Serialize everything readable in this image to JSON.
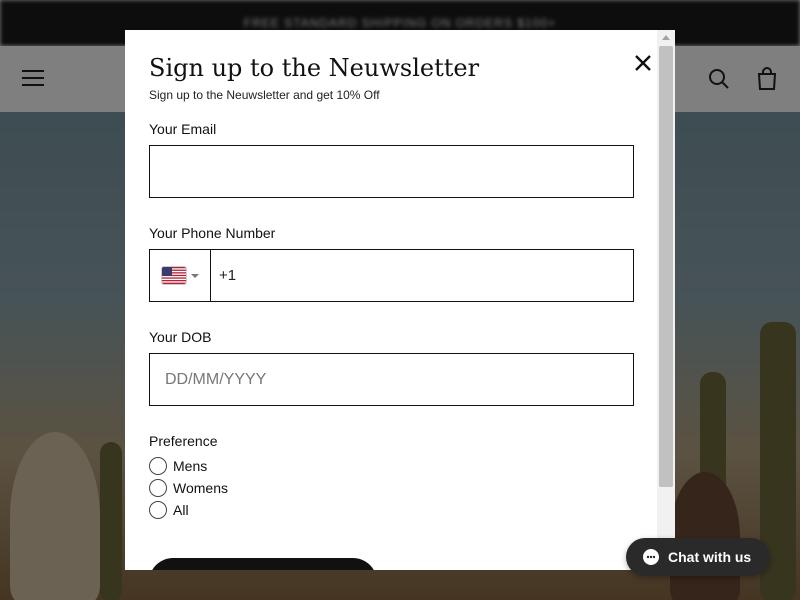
{
  "background": {
    "announcement": "FREE STANDARD SHIPPING ON ORDERS $100+"
  },
  "modal": {
    "title": "Sign up to the Neuwsletter",
    "subtitle": "Sign up to the Neuwsletter and get 10% Off",
    "close_icon": "close-icon",
    "email": {
      "label": "Your Email",
      "value": "",
      "placeholder": ""
    },
    "phone": {
      "label": "Your Phone Number",
      "country_flag": "us-flag-icon",
      "value": "+1"
    },
    "dob": {
      "label": "Your DOB",
      "value": "",
      "placeholder": "DD/MM/YYYY"
    },
    "preference": {
      "label": "Preference",
      "options": [
        "Mens",
        "Womens",
        "All"
      ]
    }
  },
  "chat": {
    "label": "Chat with us",
    "icon": "chat-bubble-icon"
  },
  "colors": {
    "accent": "#111111",
    "chat_bg": "#2a2a2a",
    "overlay": "rgba(0,0,0,0.5)"
  }
}
